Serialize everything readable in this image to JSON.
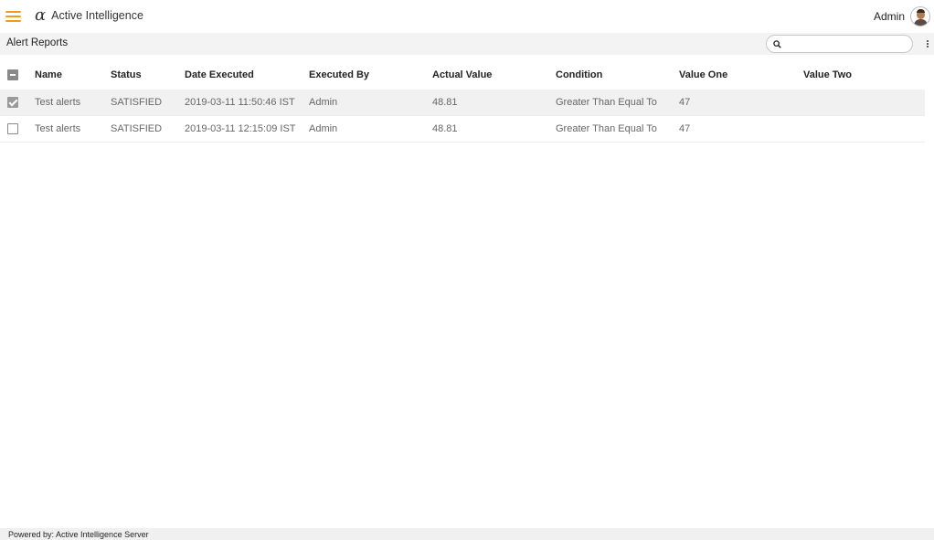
{
  "header": {
    "logo_mark": "α",
    "app_name": "Active Intelligence",
    "user_name": "Admin",
    "menu_icon": "hamburger-menu-icon",
    "avatar_icon": "user-avatar-icon",
    "accent_color": "#f29a1e"
  },
  "page": {
    "title": "Alert Reports",
    "search": {
      "placeholder": "",
      "value": "",
      "icon": "search-icon"
    },
    "more_icon": "vertical-ellipsis-icon"
  },
  "table": {
    "columns": [
      "Name",
      "Status",
      "Date Executed",
      "Executed By",
      "Actual Value",
      "Condition",
      "Value One",
      "Value Two"
    ],
    "select_all_state": "indeterminate",
    "rows": [
      {
        "selected": true,
        "name": "Test alerts",
        "status": "SATISFIED",
        "date_executed": "2019-03-11 11:50:46 IST",
        "executed_by": "Admin",
        "actual_value": "48.81",
        "condition": "Greater Than Equal To",
        "value_one": "47",
        "value_two": ""
      },
      {
        "selected": false,
        "name": "Test alerts",
        "status": "SATISFIED",
        "date_executed": "2019-03-11 12:15:09 IST",
        "executed_by": "Admin",
        "actual_value": "48.81",
        "condition": "Greater Than Equal To",
        "value_one": "47",
        "value_two": ""
      }
    ]
  },
  "footer": {
    "text": "Powered by: Active Intelligence Server"
  }
}
